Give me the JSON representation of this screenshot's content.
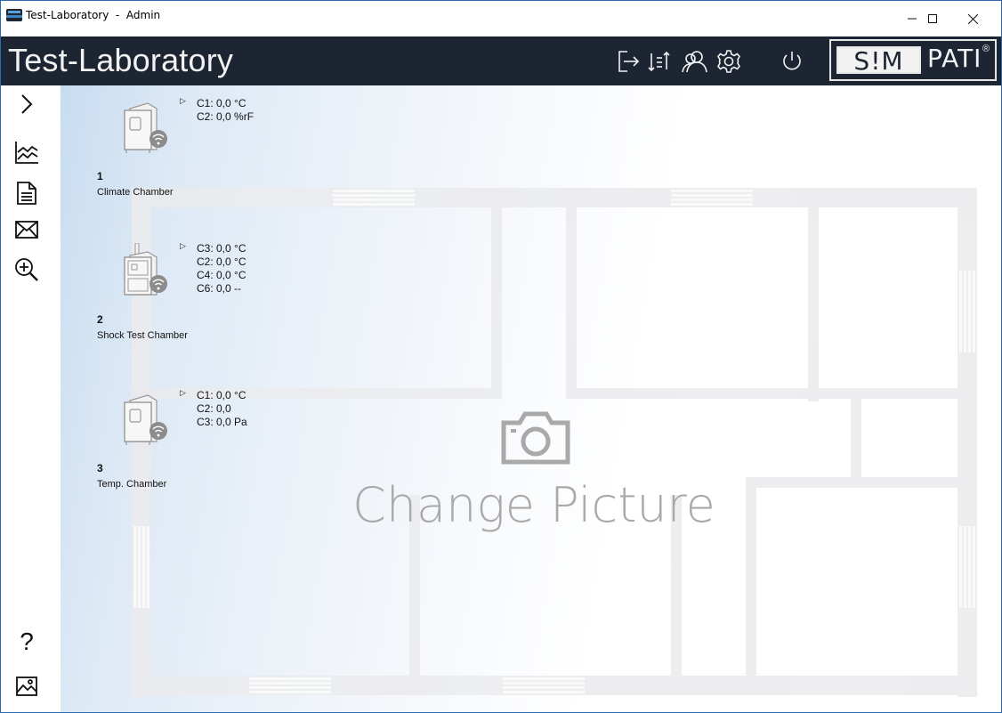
{
  "window": {
    "title": "Test-Laboratory  -  Admin"
  },
  "header": {
    "title": "Test-Laboratory",
    "icons": [
      "logout-icon",
      "sort-icon",
      "users-icon",
      "settings-icon",
      "power-icon"
    ],
    "logo_box": "S!M",
    "logo_text": "PATI",
    "logo_reg": "®"
  },
  "sidebar": {
    "icons": [
      "expand-chevron-icon",
      "chart-icon",
      "document-icon",
      "mail-icon",
      "zoom-in-icon",
      "help-icon",
      "image-icon"
    ],
    "help_label": "?"
  },
  "main": {
    "change_picture_label": "Change Picture"
  },
  "devices": [
    {
      "number": "1",
      "name": "Climate Chamber",
      "values": [
        "C1: 0,0 °C",
        "C2: 0,0 %rF"
      ]
    },
    {
      "number": "2",
      "name": "Shock Test Chamber",
      "values": [
        "C3: 0,0 °C",
        "C2: 0,0 °C",
        "C4: 0,0 °C",
        "C6: 0,0 --"
      ]
    },
    {
      "number": "3",
      "name": "Temp. Chamber",
      "values": [
        "C1: 0,0 °C",
        "C2: 0,0",
        "C3: 0,0 Pa"
      ]
    }
  ],
  "colors": {
    "header_bg": "#1d2432",
    "header_text": "#f2f2f2",
    "window_border": "#2b6cb0"
  }
}
